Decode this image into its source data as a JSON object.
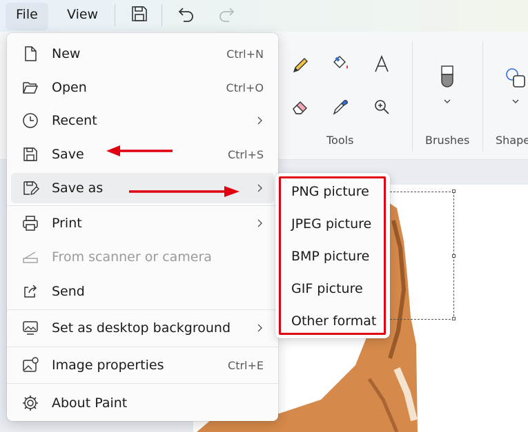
{
  "menubar": {
    "file": "File",
    "view": "View"
  },
  "ribbon": {
    "tools_label": "Tools",
    "brushes_label": "Brushes",
    "shapes_label": "Shape"
  },
  "file_menu": {
    "items": [
      {
        "label": "New",
        "shortcut": "Ctrl+N",
        "icon": "new-file-icon"
      },
      {
        "label": "Open",
        "shortcut": "Ctrl+O",
        "icon": "folder-icon"
      },
      {
        "label": "Recent",
        "icon": "clock-icon"
      },
      {
        "label": "Save",
        "shortcut": "Ctrl+S",
        "icon": "save-icon"
      },
      {
        "label": "Save as",
        "icon": "save-as-icon"
      },
      {
        "label": "Print",
        "icon": "printer-icon"
      },
      {
        "label": "From scanner or camera",
        "icon": "scanner-icon"
      },
      {
        "label": "Send",
        "icon": "share-icon"
      },
      {
        "label": "Set as desktop background",
        "icon": "desktop-icon"
      },
      {
        "label": "Image properties",
        "shortcut": "Ctrl+E",
        "icon": "image-properties-icon"
      },
      {
        "label": "About Paint",
        "icon": "gear-icon"
      }
    ]
  },
  "save_as_menu": {
    "items": [
      "PNG picture",
      "JPEG picture",
      "BMP picture",
      "GIF picture",
      "Other format"
    ]
  },
  "colors": {
    "annotation_red": "#e0000f",
    "hover": "#ecedee"
  }
}
